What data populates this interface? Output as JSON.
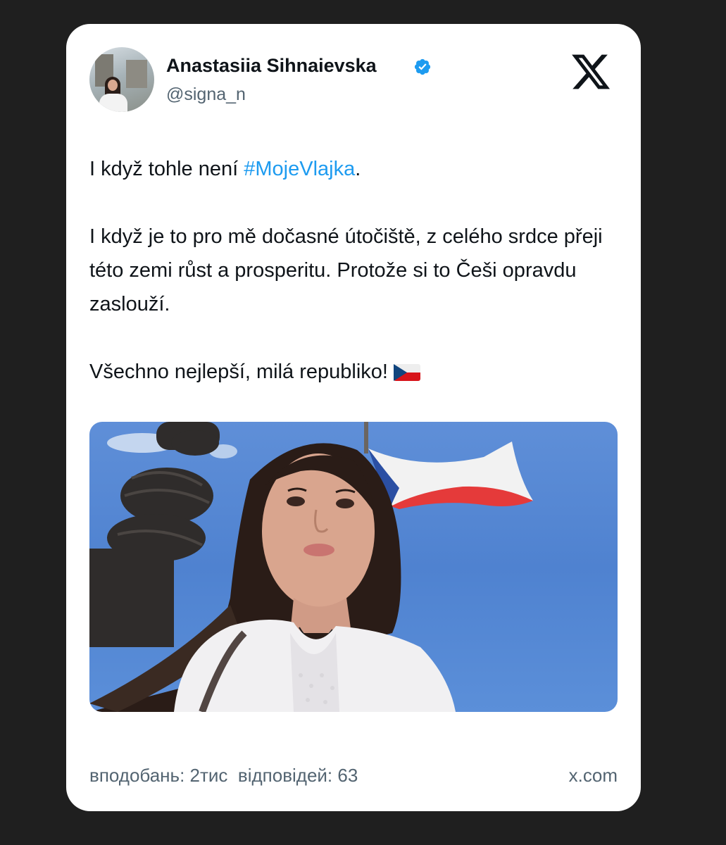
{
  "author": {
    "name": "Anastasiia Sihnaievska",
    "handle": "@signa_n"
  },
  "tweet": {
    "line1_text": "I když tohle není ",
    "line1_hashtag": "#MojeVlajka",
    "line1_end": ".",
    "paragraph2": "I když je to pro mě dočasné útočiště, z celého srdce přeji této zemi růst a prosperitu.  Protože si to Češi opravdu zaslouží.",
    "paragraph3": "Všechno nejlepší, milá republiko!"
  },
  "footer": {
    "likes_label": "вподобань:",
    "likes_value": "2тис",
    "replies_label": "відповідей:",
    "replies_value": "63",
    "domain": "x.com"
  },
  "colors": {
    "background": "#1f1f1f",
    "card": "#ffffff",
    "text": "#0f1419",
    "secondary": "#536471",
    "hashtag": "#1d9bf0",
    "verified": "#1d9bf0"
  },
  "icons": [
    "verified-badge-icon",
    "x-logo-icon",
    "czech-flag-emoji"
  ]
}
